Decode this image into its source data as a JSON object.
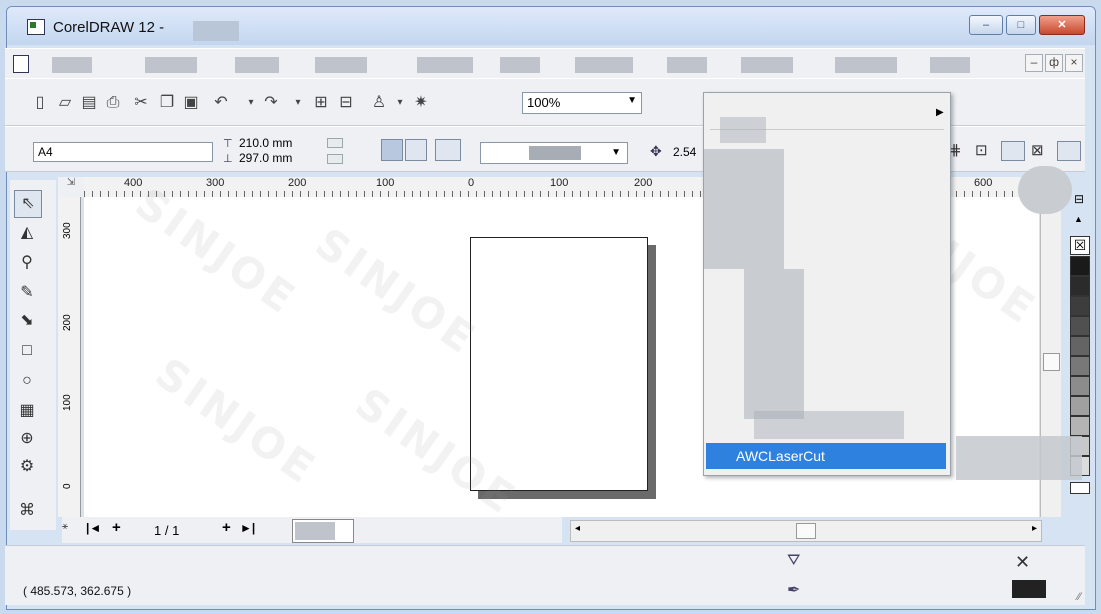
{
  "window": {
    "title": "CorelDRAW 12 -",
    "controls": {
      "minimize": "–",
      "maximize": "□",
      "close": "✕"
    }
  },
  "menubar": {
    "mdi_controls": [
      "–",
      "ф",
      "×"
    ]
  },
  "toolbar_standard": {
    "icons": [
      "new-icon",
      "open-icon",
      "save-icon",
      "print-icon",
      "cut-icon",
      "copy-icon",
      "paste-icon",
      "undo-icon",
      "redo-icon",
      "import-icon",
      "export-icon",
      "application-launcher-icon",
      "welcome-icon"
    ],
    "zoom_value": "100%"
  },
  "property_bar": {
    "paper_size": "A4",
    "width": "210.0 mm",
    "height": "297.0 mm",
    "nudge_value": "2.54"
  },
  "ruler": {
    "h_labels": [
      "400",
      "300",
      "200",
      "100",
      "0",
      "100",
      "200",
      "600"
    ],
    "v_labels": [
      "300",
      "200",
      "100",
      "0"
    ]
  },
  "page_nav": {
    "first": "|◄",
    "add_before": "+",
    "page_counter": "1 / 1",
    "add_after": "+",
    "last": "►|"
  },
  "popup_menu": {
    "highlighted_item": "AWCLaserCut"
  },
  "status": {
    "coordinates": "( 485.573, 362.675 )"
  },
  "colors": {
    "accent": "#2f81e0",
    "fill": "#222222"
  },
  "palette_swatches": [
    "#1a1a1a",
    "#2b2b2b",
    "#3d3d3d",
    "#505050",
    "#646464",
    "#787878",
    "#8c8c8c",
    "#a0a0a0",
    "#b4b4b4",
    "#c8c8c8",
    "#dcdcdc"
  ],
  "watermark": "SINJOE"
}
